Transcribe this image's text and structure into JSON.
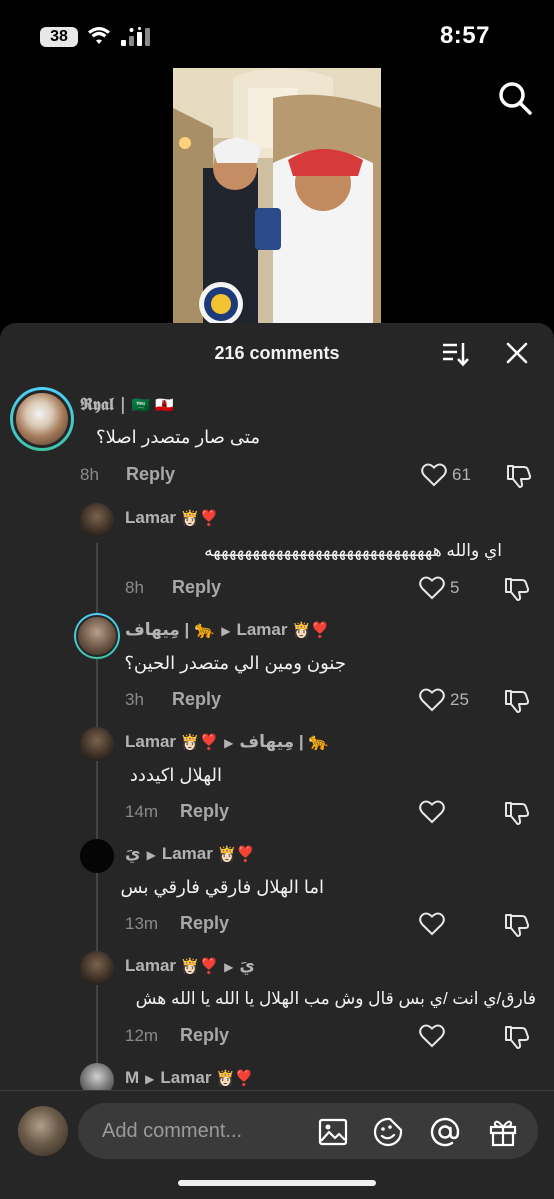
{
  "status": {
    "battery": "38",
    "time": "8:57"
  },
  "comments_header": {
    "count": "216 comments"
  },
  "comments": [
    {
      "user": "𝕽𝖞𝖆𝖑 |",
      "flags": "🇸🇦 🇬🇮",
      "text": "متى صار متصدر اصلا؟",
      "time": "8h",
      "reply": "Reply",
      "likes": "61"
    },
    {
      "user": "Lamar",
      "badges": "👸🏻❣️",
      "text": "اي والله هههههههههههههههههههههههههههههه",
      "time": "8h",
      "reply": "Reply",
      "likes": "5"
    },
    {
      "user": "مِيهاف | 🐆",
      "reply_to": "Lamar",
      "reply_to_badges": "👸🏻❣️",
      "text": "جنون ومين الي متصدر الحين؟",
      "time": "3h",
      "reply": "Reply",
      "likes": "25"
    },
    {
      "user": "Lamar",
      "badges": "👸🏻❣️",
      "reply_to": "مِيهاف | 🐆",
      "text": "الهلال اكيددد",
      "time": "14m",
      "reply": "Reply",
      "likes": ""
    },
    {
      "user": "يَ",
      "reply_to": "Lamar",
      "reply_to_badges": "👸🏻❣️",
      "text": "اما الهلال فارقي فارقي بس",
      "time": "13m",
      "reply": "Reply",
      "likes": ""
    },
    {
      "user": "Lamar",
      "badges": "👸🏻❣️",
      "reply_to": "يَ",
      "text": "فارق/ي انت /ي بس قال وش مب الهلال يا الله يا الله هش",
      "time": "12m",
      "reply": "Reply",
      "likes": ""
    },
    {
      "user": "M",
      "reply_to": "Lamar",
      "reply_to_badges": "👸🏻❣️"
    }
  ],
  "composer": {
    "placeholder": "Add comment..."
  },
  "icons": [
    "search-icon",
    "sort-icon",
    "close-icon",
    "heart-icon",
    "dislike-icon",
    "image-icon",
    "sticker-icon",
    "mention-icon",
    "gift-icon"
  ]
}
